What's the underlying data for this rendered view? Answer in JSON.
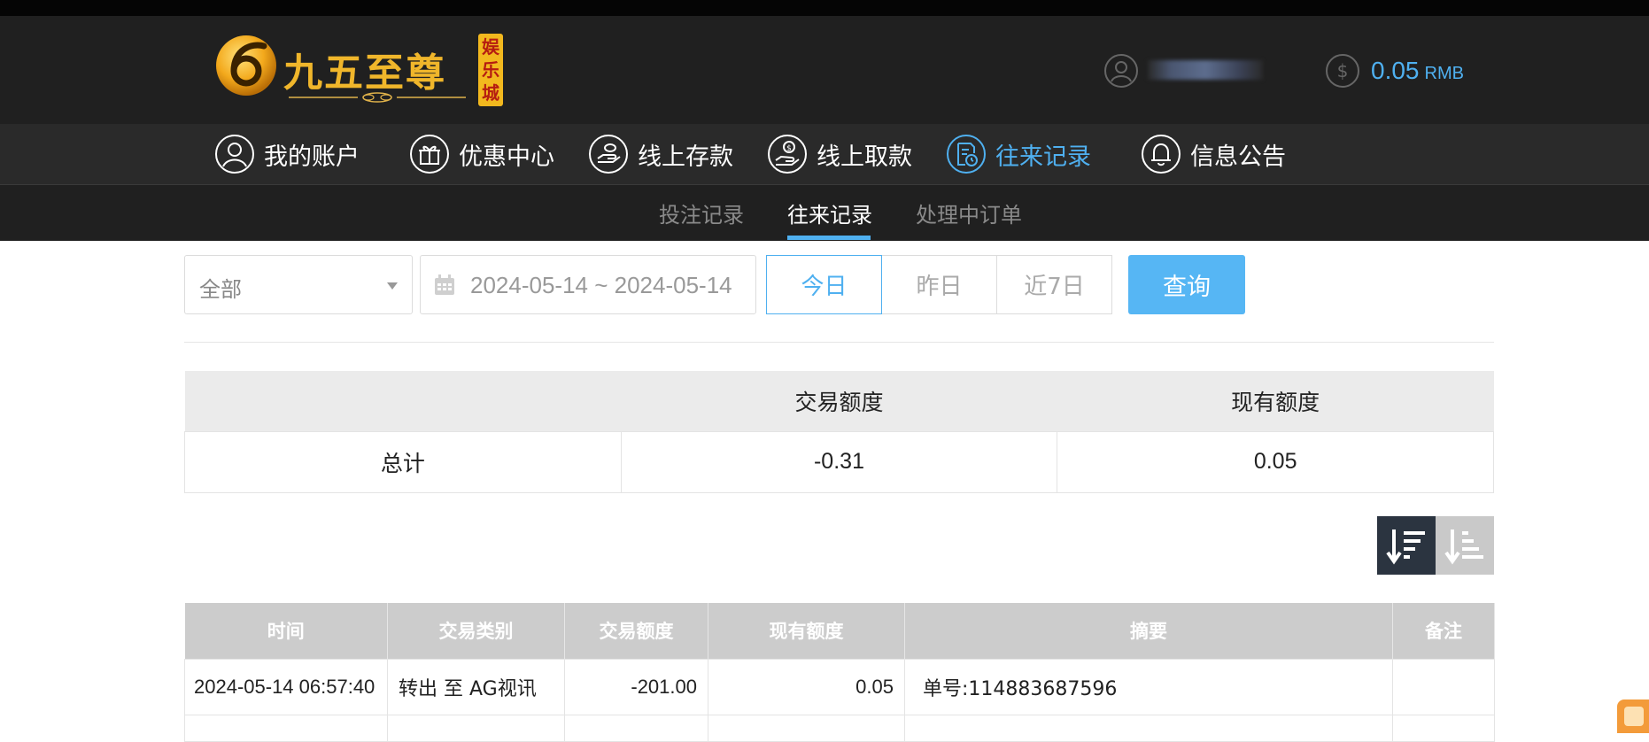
{
  "header": {
    "logo_text": "九五至尊",
    "logo_badge": "娱乐城",
    "user_name": "",
    "balance": "0.05",
    "currency": "RMB"
  },
  "nav": {
    "items": [
      {
        "label": "我的账户",
        "icon": "user-icon"
      },
      {
        "label": "优惠中心",
        "icon": "gift-icon"
      },
      {
        "label": "线上存款",
        "icon": "deposit-icon"
      },
      {
        "label": "线上取款",
        "icon": "withdraw-icon"
      },
      {
        "label": "往来记录",
        "icon": "records-icon",
        "active": true
      },
      {
        "label": "信息公告",
        "icon": "bell-icon"
      }
    ]
  },
  "subnav": {
    "items": [
      {
        "label": "投注记录"
      },
      {
        "label": "往来记录",
        "active": true
      },
      {
        "label": "处理中订单"
      }
    ]
  },
  "filters": {
    "type_select": "全部",
    "date_range": "2024-05-14 ~ 2024-05-14",
    "quick": [
      "今日",
      "昨日",
      "近7日"
    ],
    "query_label": "查询"
  },
  "summary": {
    "headers": [
      "",
      "交易额度",
      "现有额度"
    ],
    "row": {
      "label": "总计",
      "amount": "-0.31",
      "balance": "0.05"
    }
  },
  "records": {
    "headers": [
      "时间",
      "交易类别",
      "交易额度",
      "现有额度",
      "摘要",
      "备注"
    ],
    "rows": [
      {
        "time": "2024-05-14 06:57:40",
        "type": "转出 至 AG视讯",
        "amount": "-201.00",
        "balance": "0.05",
        "summary": "单号:114883687596",
        "note": ""
      }
    ]
  },
  "colors": {
    "accent": "#4fb0f0",
    "header_bg": "#202020",
    "nav_bg": "#2a2a2a",
    "logo_gold": "#f0b62b",
    "sort_active": "#2b3440"
  }
}
